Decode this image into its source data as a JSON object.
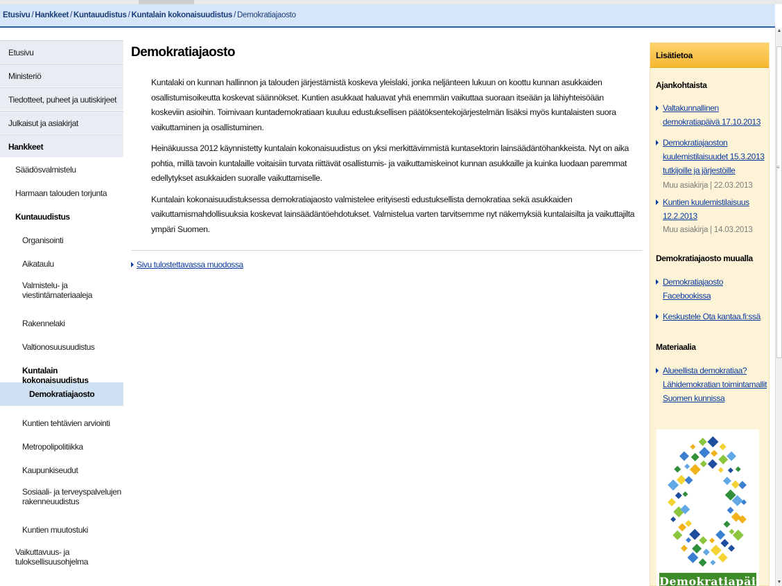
{
  "breadcrumb": {
    "items": [
      "Etusivu",
      "Hankkeet",
      "Kuntauudistus",
      "Kuntalain kokonaisuudistus"
    ],
    "separator": "/",
    "current": "Demokratiajaosto"
  },
  "sidebar": {
    "items": [
      {
        "label": "Etusivu",
        "level": 0
      },
      {
        "label": "Ministeriö",
        "level": 0
      },
      {
        "label": "Tiedotteet, puheet ja uutiskirjeet",
        "level": 0
      },
      {
        "label": "Julkaisut ja asiakirjat",
        "level": 0
      },
      {
        "label": "Hankkeet",
        "level": 0,
        "active": true
      },
      {
        "label": "Säädösvalmistelu",
        "level": 1
      },
      {
        "label": "Harmaan talouden torjunta",
        "level": 1
      },
      {
        "label": "Kuntauudistus",
        "level": 1,
        "active": true
      },
      {
        "label": "Organisointi",
        "level": 2
      },
      {
        "label": "Aikataulu",
        "level": 2
      },
      {
        "label": "Valmistelu- ja viestintämateriaaleja",
        "level": 2
      },
      {
        "label": "Rakennelaki",
        "level": 2
      },
      {
        "label": "Valtionosuusuudistus",
        "level": 2
      },
      {
        "label": "Kuntalain kokonaisuudistus",
        "level": 2,
        "active": true
      },
      {
        "label": "Demokratiajaosto",
        "level": 3,
        "selected": true
      },
      {
        "label": "Kuntien tehtävien arviointi",
        "level": 2
      },
      {
        "label": "Metropolipolitiikka",
        "level": 2
      },
      {
        "label": "Kaupunkiseudut",
        "level": 2
      },
      {
        "label": "Sosiaali- ja terveyspalvelujen rakenneuudistus",
        "level": 2
      },
      {
        "label": "Kuntien muutostuki",
        "level": 2
      },
      {
        "label": "Vaikuttavuus- ja tuloksellisuusohjelma",
        "level": 1
      }
    ]
  },
  "main": {
    "title": "Demokratiajaosto",
    "paragraphs": [
      "Kuntalaki on kunnan hallinnon ja talouden järjestämistä koskeva yleislaki, jonka neljänteen lukuun on koottu kunnan asukkaiden osallistumisoikeutta koskevat säännökset. Kuntien asukkaat haluavat yhä enemmän vaikuttaa suoraan itseään ja lähiyhteisöään koskeviin asioihin. Toimivaan kuntademokratiaan kuuluu edustuksellisen päätöksentekojärjestelmän lisäksi myös kuntalaisten suora vaikuttaminen ja osallistuminen.",
      "Heinäkuussa 2012 käynnistetty kuntalain kokonaisuudistus on yksi merkittävimmistä kuntasektorin lainsäädäntöhankkeista. Nyt on aika pohtia, millä tavoin kuntalaille voitaisiin turvata riittävät osallistumis- ja vaikuttamiskeinot kunnan asukkaille ja kuinka luodaan paremmat edellytykset asukkaiden suoralle vaikuttamiselle.",
      "Kuntalain kokonaisuudistuksessa demokratiajaosto valmistelee erityisesti edustuksellista demokratiaa sekä asukkaiden vaikuttamismahdollisuuksia koskevat lainsäädäntöehdotukset.  Valmistelua varten tarvitsemme nyt näkemyksiä kuntalaisilta ja vaikuttajilta ympäri Suomen."
    ],
    "print_link": "Sivu tulostettavassa muodossa"
  },
  "aside": {
    "header": "Lisätietoa",
    "sections": [
      {
        "title": "Ajankohtaista",
        "links": [
          {
            "label": "Valtakunnallinen demokratiapäivä 17.10.2013",
            "meta": ""
          },
          {
            "label": "Demokratiajaoston kuulemistilaisuudet 15.3.2013 tutkijoille ja järjestöille",
            "meta": "Muu asiakirja  |  22.03.2013"
          },
          {
            "label": "Kuntien kuulemistilaisuus 12.2.2013",
            "meta": "Muu asiakirja  |  14.03.2013"
          }
        ]
      },
      {
        "title": "Demokratiajaosto muualla",
        "links": [
          {
            "label": "Demokratiajaosto Facebookissa",
            "meta": ""
          },
          {
            "label": "Keskustele Ota kantaa.fi:ssä",
            "meta": ""
          }
        ]
      },
      {
        "title": "Materiaalia",
        "links": [
          {
            "label": "Alueellista demokratiaa? Lähidemokratian toimintamallit Suomen kunnissa",
            "meta": ""
          }
        ]
      }
    ],
    "banner_text": "Demokratiapäivä",
    "colors": {
      "header": "#f6b832",
      "background": "#fdf4d8",
      "banner_green": "#3e8b2a"
    }
  }
}
